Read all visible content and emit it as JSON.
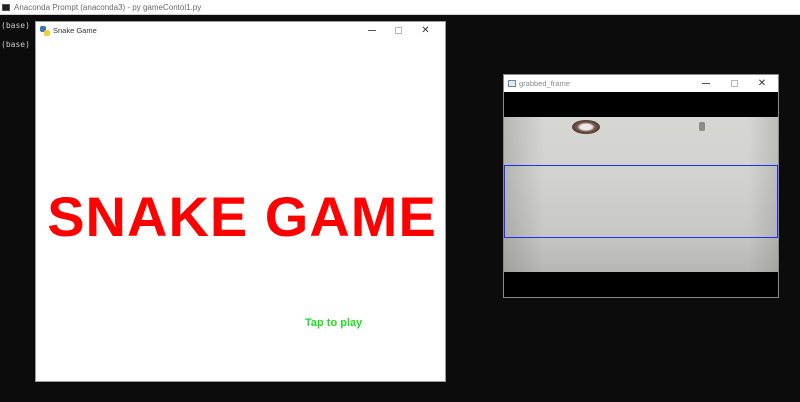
{
  "console": {
    "title": "Anaconda Prompt (anaconda3) - py  gameContol1.py",
    "lines": [
      "(base) C:",
      "(base) C:"
    ]
  },
  "game_window": {
    "title": "Snake Game",
    "heading": "SNAKE GAME",
    "prompt": "Tap to play",
    "minimize_symbol": "",
    "close_symbol": "✕"
  },
  "frame_window": {
    "title": "grabbed_frame",
    "close_symbol": "✕"
  },
  "colors": {
    "heading": "#ff0000",
    "prompt": "#22dd22",
    "detection_box": "#1c2cff",
    "console_background": "#0c0c0c"
  },
  "icons": {
    "console": "terminal-icon",
    "game": "python-icon",
    "frame": "image-window-icon"
  }
}
